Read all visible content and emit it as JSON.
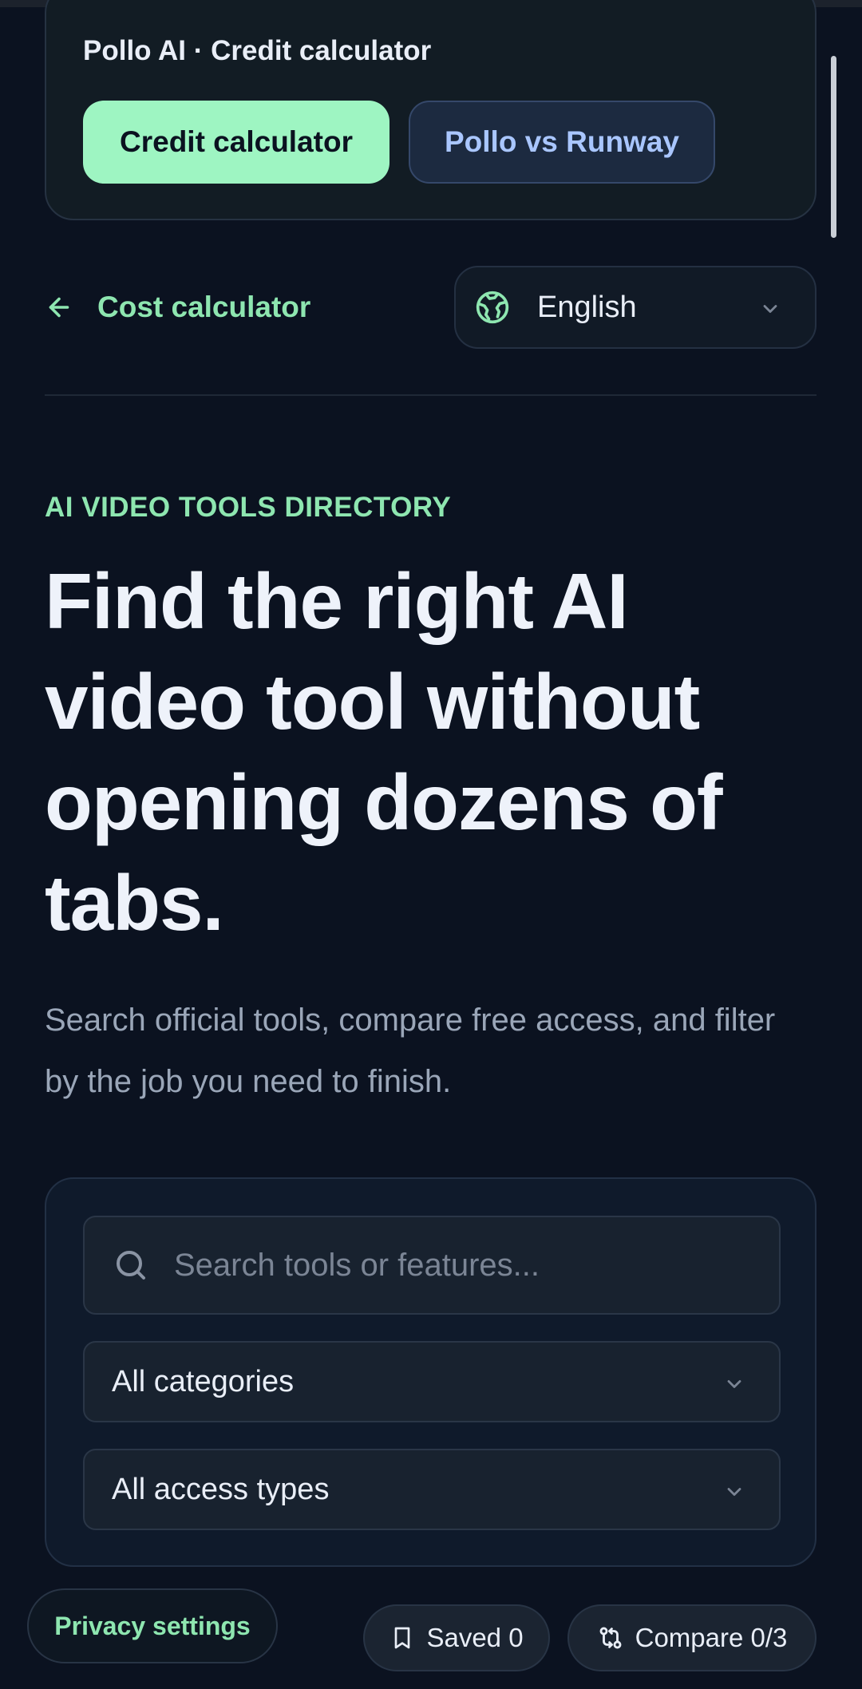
{
  "promo": {
    "title": "Pollo AI · Credit calculator",
    "primary_label": "Credit calculator",
    "secondary_label": "Pollo vs Runway"
  },
  "nav": {
    "back_label": "Cost calculator",
    "language": "English"
  },
  "hero": {
    "eyebrow": "AI VIDEO TOOLS DIRECTORY",
    "title": "Find the right AI video tool without opening dozens of tabs.",
    "subtitle": "Search official tools, compare free access, and filter by the job you need to finish."
  },
  "filters": {
    "search_placeholder": "Search tools or features...",
    "category": "All categories",
    "access_type": "All access types"
  },
  "footer": {
    "privacy_label": "Privacy settings",
    "saved_label": "Saved 0",
    "compare_label": "Compare 0/3"
  },
  "colors": {
    "background": "#0b1220",
    "accent_green": "#9ef5c2",
    "accent_blue": "#a9c6ff"
  },
  "icons": [
    "arrow-left-icon",
    "globe-icon",
    "chevron-down-icon",
    "search-icon",
    "bookmark-icon",
    "compare-icon"
  ]
}
